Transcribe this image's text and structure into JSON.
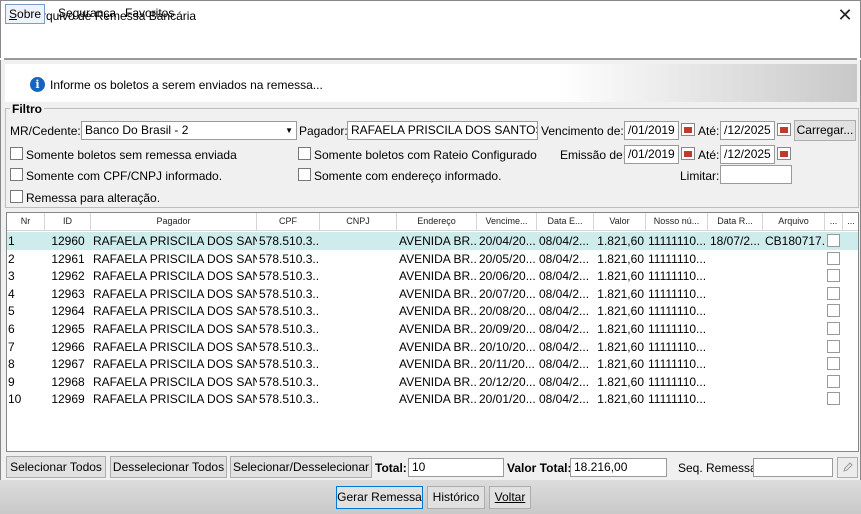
{
  "window": {
    "title": "Arquivo de Remessa Bancária",
    "close_glyph": "✕"
  },
  "menu": {
    "sobre": "Sobre",
    "seguranca": "Segurança",
    "favoritos": "Favoritos"
  },
  "info": {
    "text": "Informe os boletos a serem enviados na remessa...",
    "icon": "info-icon"
  },
  "filter": {
    "legend": "Filtro",
    "cedente_label": "MR/Cedente:",
    "cedente_value": "Banco Do Brasil - 2",
    "pagador_label": "Pagador:",
    "pagador_value": "RAFAELA PRISCILA DOS SANTOS",
    "vencimento_label": "Vencimento de:",
    "vencimento_de": "/01/2019",
    "ate_label": "Até:",
    "vencimento_ate": "/12/2025",
    "carregar": "Carregar...",
    "chk_sem_remessa": "Somente boletos sem remessa enviada",
    "chk_rateio": "Somente boletos com Rateio Configurado",
    "emissao_label": "Emissão de:",
    "emissao_de": "/01/2019",
    "emissao_ate": "/12/2025",
    "chk_cpf": "Somente com CPF/CNPJ informado.",
    "chk_endereco": "Somente com endereço informado.",
    "limitar_label": "Limitar:",
    "limitar_value": "",
    "chk_alteracao": "Remessa para alteração."
  },
  "table": {
    "columns": [
      "Nr",
      "ID",
      "Pagador",
      "CPF",
      "CNPJ",
      "Endereço",
      "Vencime...",
      "Data E...",
      "Valor",
      "Nosso nú...",
      "Data R...",
      "Arquivo",
      "...",
      "..."
    ],
    "rows": [
      [
        "1",
        "12960",
        "RAFAELA PRISCILA DOS SAN...",
        "578.510.3...",
        "",
        "AVENIDA BR...",
        "20/04/20...",
        "08/04/2...",
        "1.821,60",
        "11111110...",
        "18/07/2...",
        "CB180717..."
      ],
      [
        "2",
        "12961",
        "RAFAELA PRISCILA DOS SAN...",
        "578.510.3...",
        "",
        "AVENIDA BR...",
        "20/05/20...",
        "08/04/2...",
        "1.821,60",
        "11111110...",
        "",
        ""
      ],
      [
        "3",
        "12962",
        "RAFAELA PRISCILA DOS SAN...",
        "578.510.3...",
        "",
        "AVENIDA BR...",
        "20/06/20...",
        "08/04/2...",
        "1.821,60",
        "11111110...",
        "",
        ""
      ],
      [
        "4",
        "12963",
        "RAFAELA PRISCILA DOS SAN...",
        "578.510.3...",
        "",
        "AVENIDA BR...",
        "20/07/20...",
        "08/04/2...",
        "1.821,60",
        "11111110...",
        "",
        ""
      ],
      [
        "5",
        "12964",
        "RAFAELA PRISCILA DOS SAN...",
        "578.510.3...",
        "",
        "AVENIDA BR...",
        "20/08/20...",
        "08/04/2...",
        "1.821,60",
        "11111110...",
        "",
        ""
      ],
      [
        "6",
        "12965",
        "RAFAELA PRISCILA DOS SAN...",
        "578.510.3...",
        "",
        "AVENIDA BR...",
        "20/09/20...",
        "08/04/2...",
        "1.821,60",
        "11111110...",
        "",
        ""
      ],
      [
        "7",
        "12966",
        "RAFAELA PRISCILA DOS SAN...",
        "578.510.3...",
        "",
        "AVENIDA BR...",
        "20/10/20...",
        "08/04/2...",
        "1.821,60",
        "11111110...",
        "",
        ""
      ],
      [
        "8",
        "12967",
        "RAFAELA PRISCILA DOS SAN...",
        "578.510.3...",
        "",
        "AVENIDA BR...",
        "20/11/20...",
        "08/04/2...",
        "1.821,60",
        "11111110...",
        "",
        ""
      ],
      [
        "9",
        "12968",
        "RAFAELA PRISCILA DOS SAN...",
        "578.510.3...",
        "",
        "AVENIDA BR...",
        "20/12/20...",
        "08/04/2...",
        "1.821,60",
        "11111110...",
        "",
        ""
      ],
      [
        "10",
        "12969",
        "RAFAELA PRISCILA DOS SAN...",
        "578.510.3...",
        "",
        "AVENIDA BR...",
        "20/01/20...",
        "08/04/2...",
        "1.821,60",
        "11111110...",
        "",
        ""
      ]
    ],
    "selected_row": 1,
    "selected_color": "#cdeceb"
  },
  "footer": {
    "selecionar_todos": "Selecionar Todos",
    "desselecionar_todos": "Desselecionar Todos",
    "selecionar_desselecionar": "Selecionar/Desselecionar",
    "total_label": "Total:",
    "total_value": "10",
    "valor_total_label": "Valor Total:",
    "valor_total_value": "18.216,00",
    "seq_remessa_label": "Seq. Remessa:",
    "seq_remessa_value": "",
    "edit_icon": "pencil-icon"
  },
  "actions": {
    "gerar": "Gerar Remessa",
    "historico": "Histórico",
    "voltar": "Voltar"
  }
}
